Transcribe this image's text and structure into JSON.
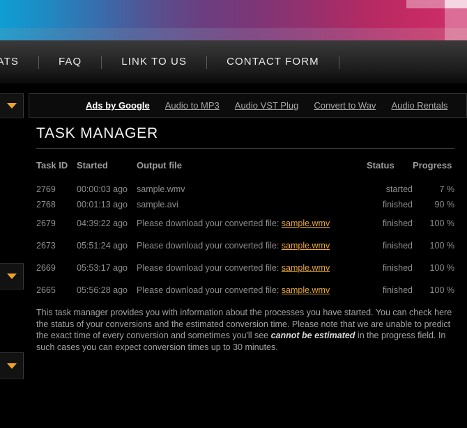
{
  "banner": {
    "name": "decorative-gradient-banner"
  },
  "nav": {
    "items": [
      {
        "label": "MATS"
      },
      {
        "label": "FAQ"
      },
      {
        "label": "LINK TO US"
      },
      {
        "label": "CONTACT FORM"
      }
    ]
  },
  "rail": {
    "caret_color": "#eda32a",
    "buttons": [
      {
        "name": "dropdown-toggle-1"
      },
      {
        "name": "dropdown-toggle-2"
      },
      {
        "name": "dropdown-toggle-3"
      }
    ]
  },
  "ads": {
    "label": "Ads by Google",
    "links": [
      {
        "label": "Audio to MP3"
      },
      {
        "label": "Audio VST Plug"
      },
      {
        "label": "Convert to Wav"
      },
      {
        "label": "Audio Rentals"
      }
    ]
  },
  "main": {
    "title": "TASK MANAGER",
    "columns": {
      "id": "Task ID",
      "started": "Started",
      "output": "Output file",
      "status": "Status",
      "progress": "Progress"
    },
    "rows": [
      {
        "id": "2769",
        "started": "00:00:03 ago",
        "output_text": "sample.wmv",
        "output_prefix": "",
        "link": "",
        "status": "started",
        "progress": "7 %",
        "tall": false
      },
      {
        "id": "2768",
        "started": "00:01:13 ago",
        "output_text": "sample.avi",
        "output_prefix": "",
        "link": "",
        "status": "finished",
        "progress": "90 %",
        "tall": false
      },
      {
        "id": "2679",
        "started": "04:39:22 ago",
        "output_text": "",
        "output_prefix": "Please download your converted file: ",
        "link": "sample.wmv",
        "status": "finished",
        "progress": "100 %",
        "tall": true
      },
      {
        "id": "2673",
        "started": "05:51:24 ago",
        "output_text": "",
        "output_prefix": "Please download your converted file: ",
        "link": "sample.wmv",
        "status": "finished",
        "progress": "100 %",
        "tall": true
      },
      {
        "id": "2669",
        "started": "05:53:17 ago",
        "output_text": "",
        "output_prefix": "Please download your converted file: ",
        "link": "sample.wmv",
        "status": "finished",
        "progress": "100 %",
        "tall": true
      },
      {
        "id": "2665",
        "started": "05:56:28 ago",
        "output_text": "",
        "output_prefix": "Please download your converted file: ",
        "link": "sample.wmv",
        "status": "finished",
        "progress": "100 %",
        "tall": true
      }
    ]
  },
  "blurb": {
    "part1": "This task manager provides you with information about the processes you have started. You can check here the status of your conversions and the estimated conversion time. Please note that we are unable to predict the exact time of every conversion and sometimes you'll see ",
    "emphasis": "cannot be estimated",
    "part2": " in the progress field. In such cases you can expect conversion times up to 30 minutes."
  }
}
